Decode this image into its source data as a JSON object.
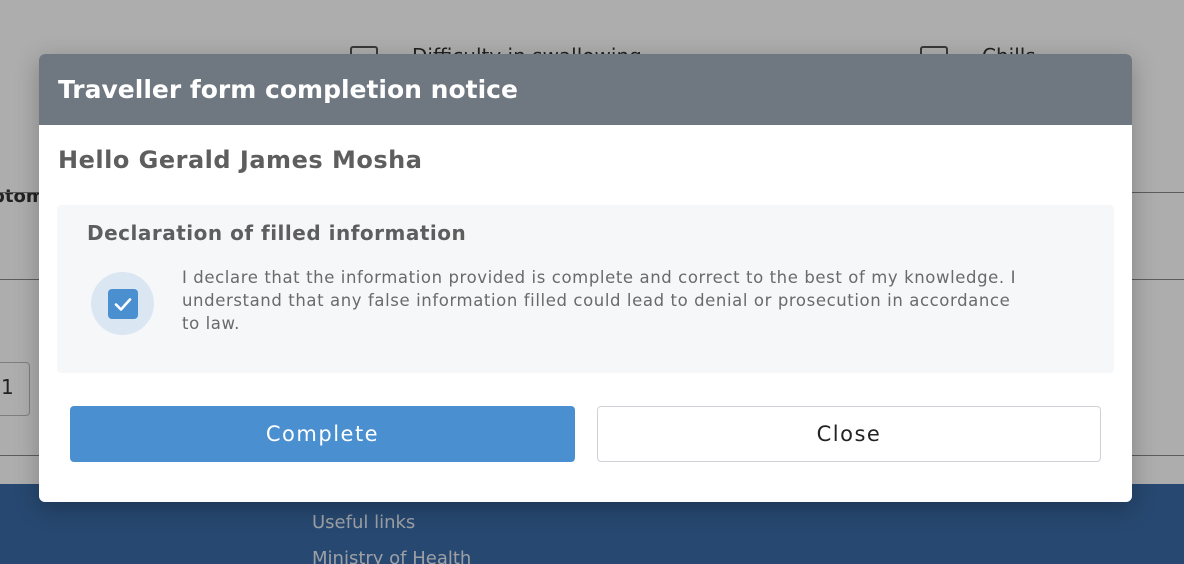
{
  "background": {
    "symptoms": [
      "Difficulty in swallowing",
      "Chills"
    ],
    "side_label": "ptom",
    "field_value": "1",
    "footer": {
      "links": [
        "Useful links",
        "Ministry of Health"
      ]
    }
  },
  "modal": {
    "title": "Traveller form completion notice",
    "greeting": "Hello Gerald James Mosha",
    "declaration": {
      "heading": "Declaration of filled information",
      "checked": true,
      "line1": "I declare that the information provided is complete and correct to the best of my knowledge. I",
      "line2": "understand that any false information filled could lead to denial or prosecution in accordance",
      "line3": "to law."
    },
    "buttons": {
      "complete_label": "Complete",
      "close_label": "Close"
    }
  },
  "colors": {
    "header_bg": "#6f7780",
    "accent": "#4a8fd0",
    "footer_bg": "#3a6aa6"
  },
  "icons": {
    "checkbox": "check-icon"
  }
}
